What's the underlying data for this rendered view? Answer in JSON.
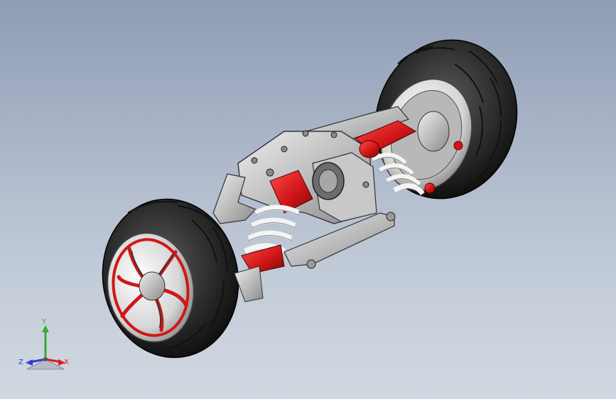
{
  "viewport": {
    "background_top": "#8f9cb4",
    "background_bottom": "#d2d8e1"
  },
  "model": {
    "accent_color": "#d11717",
    "tire_color": "#2c2c2c",
    "metal_color": "#c9c9c9"
  },
  "triad": {
    "x_label": "X",
    "y_label": "Y",
    "z_label": "Z",
    "x_color": "#d42020",
    "y_color": "#2fae2f",
    "z_color": "#2b3fd6"
  }
}
